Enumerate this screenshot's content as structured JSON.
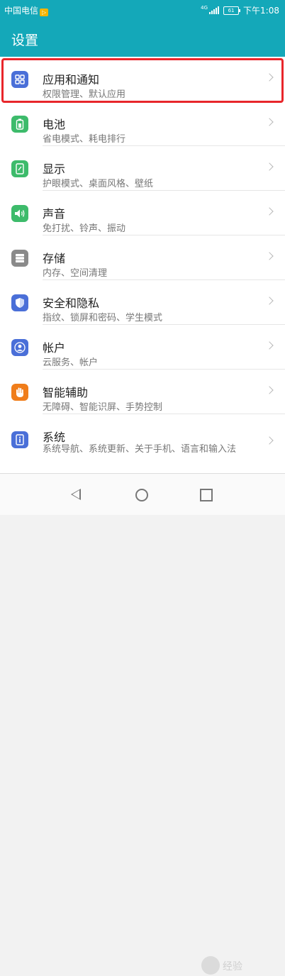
{
  "status_bar": {
    "carrier": "中国电信",
    "sim_badge": "▷",
    "network": "4G",
    "battery": "61",
    "time": "下午1:08"
  },
  "app_bar": {
    "title": "设置"
  },
  "items": [
    {
      "label": "应用和通知",
      "sub": "权限管理、默认应用",
      "icon": "apps-grid-icon",
      "color": "#4a6fd8"
    },
    {
      "label": "电池",
      "sub": "省电模式、耗电排行",
      "icon": "battery-icon",
      "color": "#3dbb6b"
    },
    {
      "label": "显示",
      "sub": "护眼模式、桌面风格、壁纸",
      "icon": "display-icon",
      "color": "#3dbb6b"
    },
    {
      "label": "声音",
      "sub": "免打扰、铃声、振动",
      "icon": "speaker-icon",
      "color": "#3dbb6b"
    },
    {
      "label": "存储",
      "sub": "内存、空间清理",
      "icon": "storage-icon",
      "color": "#8a8a8a"
    },
    {
      "label": "安全和隐私",
      "sub": "指纹、锁屏和密码、学生模式",
      "icon": "shield-icon",
      "color": "#4a6fd8"
    },
    {
      "label": "帐户",
      "sub": "云服务、帐户",
      "icon": "account-icon",
      "color": "#4a6fd8"
    },
    {
      "label": "智能辅助",
      "sub": "无障碍、智能识屏、手势控制",
      "icon": "hand-icon",
      "color": "#f07d1a"
    },
    {
      "label": "系统",
      "sub": "系统导航、系统更新、关于手机、语言和输入法",
      "icon": "system-info-icon",
      "color": "#4a6fd8"
    }
  ],
  "watermark": "经验"
}
